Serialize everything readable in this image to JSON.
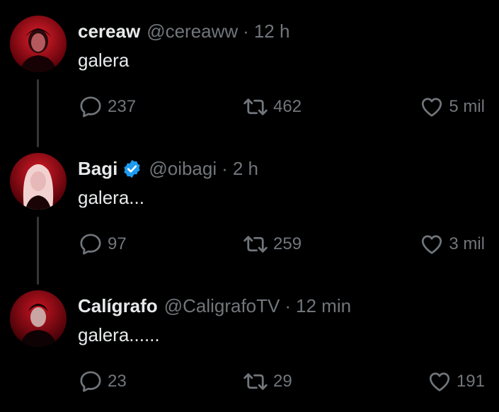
{
  "tweets": [
    {
      "name": "cereaw",
      "verified": false,
      "handle": "@cereaww",
      "separator": "·",
      "time": "12 h",
      "text": "galera",
      "replies": "237",
      "retweets": "462",
      "likes": "5 mil",
      "avatar_icon": "avatar-icon"
    },
    {
      "name": "Bagi",
      "verified": true,
      "handle": "@oibagi",
      "separator": "·",
      "time": "2 h",
      "text": "galera...",
      "replies": "97",
      "retweets": "259",
      "likes": "3 mil",
      "avatar_icon": "avatar-icon"
    },
    {
      "name": "Calígrafo",
      "verified": false,
      "handle": "@CaligrafoTV",
      "separator": "·",
      "time": "12 min",
      "text": "galera......",
      "replies": "23",
      "retweets": "29",
      "likes": "191",
      "avatar_icon": "avatar-icon"
    }
  ],
  "icons": {
    "reply": "comment-bubble-icon",
    "retweet": "retweet-arrows-icon",
    "like": "heart-icon",
    "verified": "verified-badge-icon"
  },
  "colors": {
    "background": "#000000",
    "primary_text": "#e7e9ea",
    "secondary_text": "#71767b",
    "verified_blue": "#1d9bf0",
    "thread_line": "#333639",
    "avatar_red": "#c0101e"
  }
}
